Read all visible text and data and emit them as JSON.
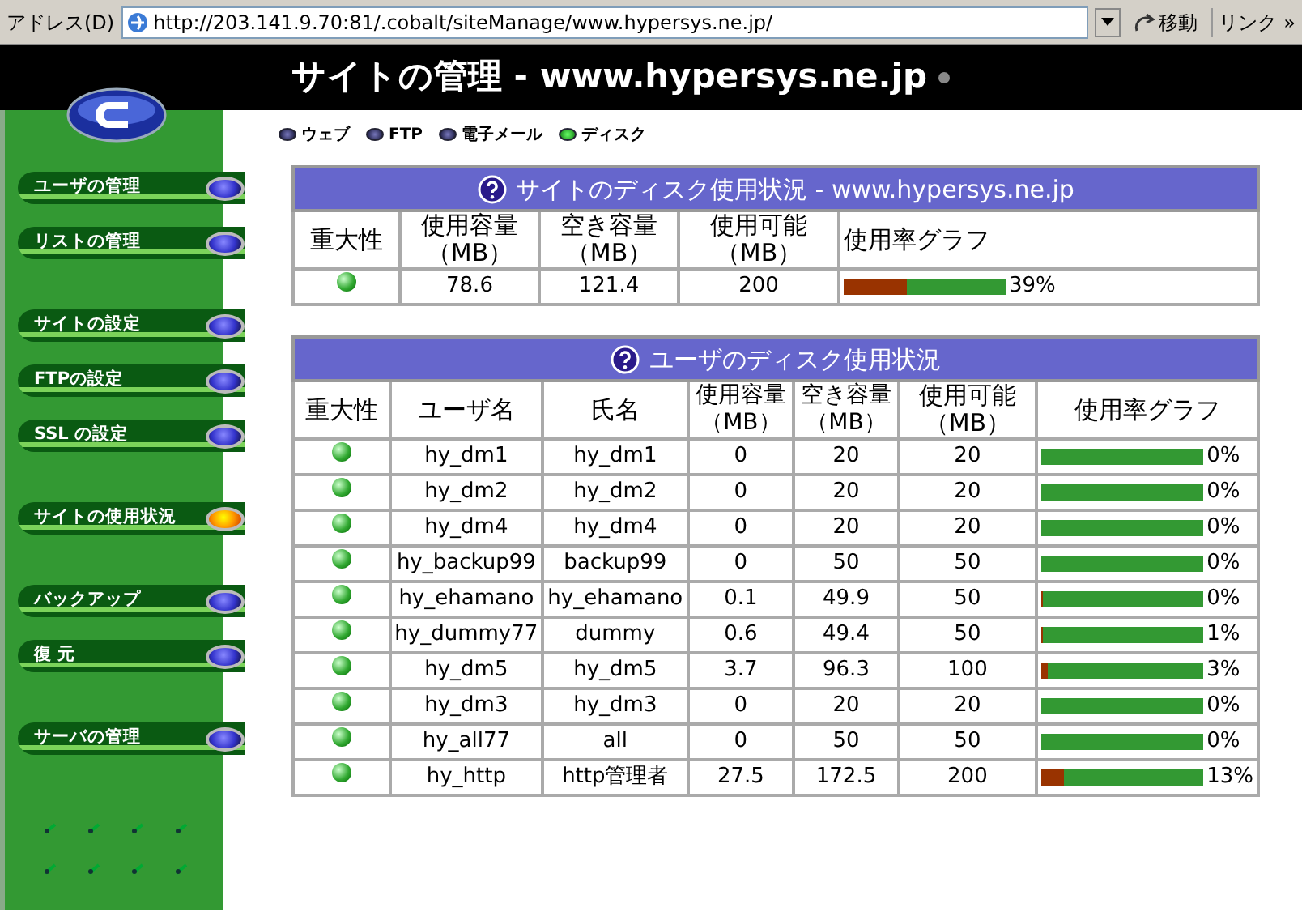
{
  "address_bar": {
    "label": "アドレス(D)",
    "url": "http://203.141.9.70:81/.cobalt/siteManage/www.hypersys.ne.jp/",
    "go_button": "移動",
    "links": "リンク",
    "chevron": "»"
  },
  "header": {
    "title": "サイトの管理 - www.hypersys.ne.jp"
  },
  "tabs": [
    {
      "label": "ウェブ",
      "selected": false
    },
    {
      "label": "FTP",
      "selected": false
    },
    {
      "label": "電子メール",
      "selected": false
    },
    {
      "label": "ディスク",
      "selected": true
    }
  ],
  "sidebar": {
    "groups": [
      [
        {
          "label": "ユーザの管理",
          "selected": false
        },
        {
          "label": "リストの管理",
          "selected": false
        }
      ],
      [
        {
          "label": "サイトの設定",
          "selected": false
        },
        {
          "label": "FTPの設定",
          "selected": false
        },
        {
          "label": "SSL の設定",
          "selected": false
        }
      ],
      [
        {
          "label": "サイトの使用状況",
          "selected": true
        }
      ],
      [
        {
          "label": "バックアップ",
          "selected": false
        },
        {
          "label": "復 元",
          "selected": false
        }
      ],
      [
        {
          "label": "サーバの管理",
          "selected": false
        }
      ]
    ]
  },
  "site_usage": {
    "title": "サイトのディスク使用状況 - www.hypersys.ne.jp",
    "columns": [
      "重大性",
      "使用容量（MB）",
      "空き容量（MB）",
      "使用可能（MB）",
      "使用率グラフ"
    ],
    "rows": [
      {
        "used": "78.6",
        "free": "121.4",
        "available": "200",
        "level": 0.39,
        "reading": "39%"
      }
    ]
  },
  "user_usage": {
    "title": "ユーザのディスク使用状況",
    "columns": [
      "重大性",
      "ユーザ名",
      "氏名",
      "使用容量（MB）",
      "空き容量（MB）",
      "使用可能（MB）",
      "使用率グラフ"
    ],
    "rows": [
      {
        "user": "hy_dm1",
        "name": "hy_dm1",
        "used": "0",
        "free": "20",
        "available": "20",
        "level": 0,
        "reading": "0%"
      },
      {
        "user": "hy_dm2",
        "name": "hy_dm2",
        "used": "0",
        "free": "20",
        "available": "20",
        "level": 0,
        "reading": "0%"
      },
      {
        "user": "hy_dm4",
        "name": "hy_dm4",
        "used": "0",
        "free": "20",
        "available": "20",
        "level": 0,
        "reading": "0%"
      },
      {
        "user": "hy_backup99",
        "name": "backup99",
        "used": "0",
        "free": "50",
        "available": "50",
        "level": 0,
        "reading": "0%"
      },
      {
        "user": "hy_ehamano",
        "name": "hy_ehamano",
        "used": "0.1",
        "free": "49.9",
        "available": "50",
        "level": 0.002,
        "reading": "0%"
      },
      {
        "user": "hy_dummy77",
        "name": "dummy",
        "used": "0.6",
        "free": "49.4",
        "available": "50",
        "level": 0.012,
        "reading": "1%"
      },
      {
        "user": "hy_dm5",
        "name": "hy_dm5",
        "used": "3.7",
        "free": "96.3",
        "available": "100",
        "level": 0.037,
        "reading": "3%"
      },
      {
        "user": "hy_dm3",
        "name": "hy_dm3",
        "used": "0",
        "free": "20",
        "available": "20",
        "level": 0,
        "reading": "0%"
      },
      {
        "user": "hy_all77",
        "name": "all",
        "used": "0",
        "free": "50",
        "available": "50",
        "level": 0,
        "reading": "0%"
      },
      {
        "user": "hy_http",
        "name": "http管理者",
        "used": "27.5",
        "free": "172.5",
        "available": "200",
        "level": 0.1375,
        "reading": "13%"
      }
    ]
  }
}
